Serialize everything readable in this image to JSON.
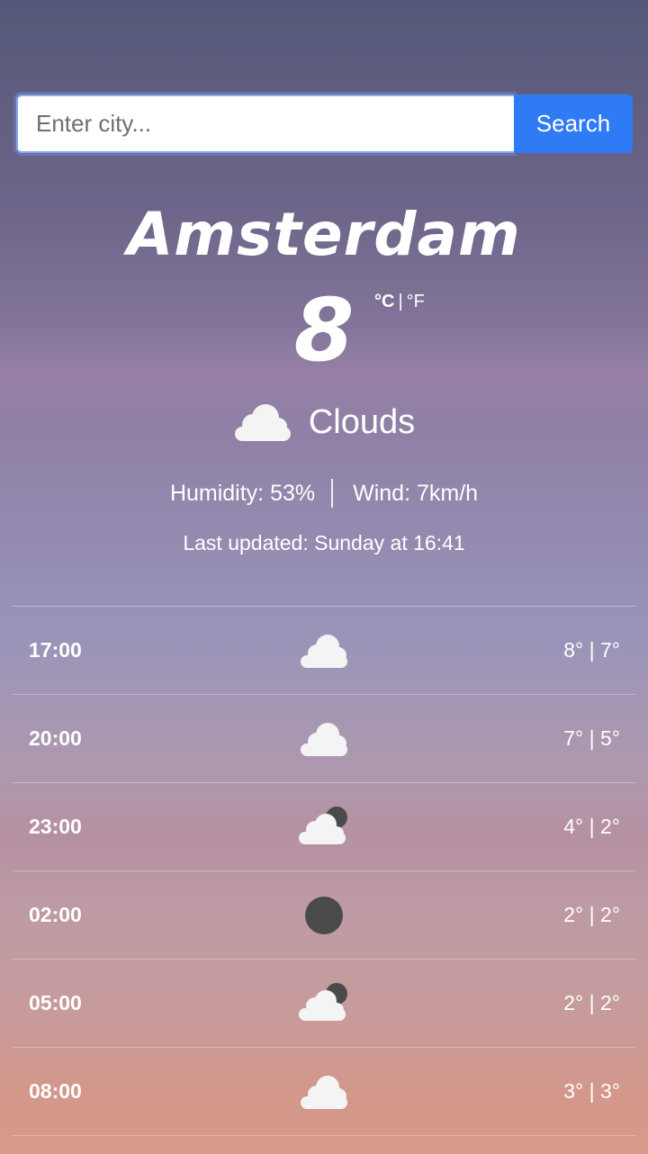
{
  "search": {
    "placeholder": "Enter city...",
    "button_label": "Search"
  },
  "current": {
    "city": "Amsterdam",
    "temperature": "8",
    "unit_celsius": "°C",
    "unit_separator": "|",
    "unit_fahrenheit": "°F",
    "condition": "Clouds",
    "condition_icon": "cloud-icon",
    "humidity": "Humidity: 53%",
    "wind": "Wind: 7km/h",
    "last_updated": "Last updated: Sunday at 16:41"
  },
  "forecast": [
    {
      "time": "17:00",
      "icon": "cloud-icon",
      "range": "8° | 7°"
    },
    {
      "time": "20:00",
      "icon": "cloud-icon",
      "range": "7° | 5°"
    },
    {
      "time": "23:00",
      "icon": "cloud-moon-icon",
      "range": "4° | 2°"
    },
    {
      "time": "02:00",
      "icon": "moon-icon",
      "range": "2° | 2°"
    },
    {
      "time": "05:00",
      "icon": "cloud-moon-icon",
      "range": "2° | 2°"
    },
    {
      "time": "08:00",
      "icon": "cloud-icon",
      "range": "3° | 3°"
    }
  ],
  "colors": {
    "accent": "#2f7af5",
    "text": "#ffffff"
  }
}
